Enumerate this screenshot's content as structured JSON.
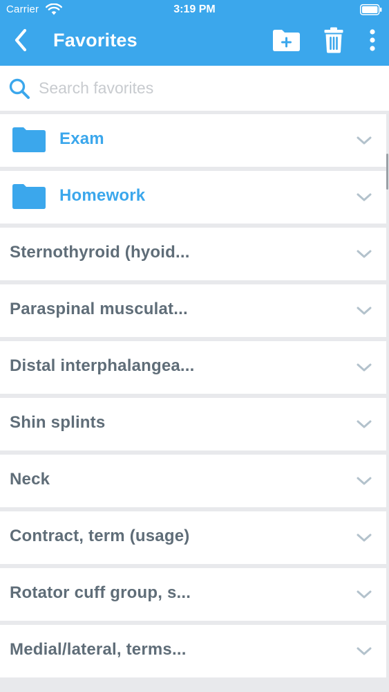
{
  "status_bar": {
    "carrier": "Carrier",
    "time": "3:19 PM"
  },
  "nav": {
    "title": "Favorites",
    "back_icon": "chevron-left-icon",
    "add_folder_icon": "folder-plus-icon",
    "trash_icon": "trash-icon",
    "more_icon": "more-vertical-icon"
  },
  "search": {
    "placeholder": "Search favorites",
    "value": ""
  },
  "colors": {
    "accent": "#3ba7ec",
    "text": "#5f6d78",
    "chevron": "#b3c2cc",
    "background": "#e8e9ec"
  },
  "folders": [
    {
      "label": "Exam",
      "icon": "folder-icon"
    },
    {
      "label": "Homework",
      "icon": "folder-icon"
    }
  ],
  "items": [
    {
      "label": "Sternothyroid (hyoid..."
    },
    {
      "label": "Paraspinal musculat..."
    },
    {
      "label": "Distal interphalangea..."
    },
    {
      "label": "Shin splints"
    },
    {
      "label": "Neck"
    },
    {
      "label": "Contract, term (usage)"
    },
    {
      "label": "Rotator cuff group, s..."
    },
    {
      "label": "Medial/lateral, terms..."
    }
  ]
}
